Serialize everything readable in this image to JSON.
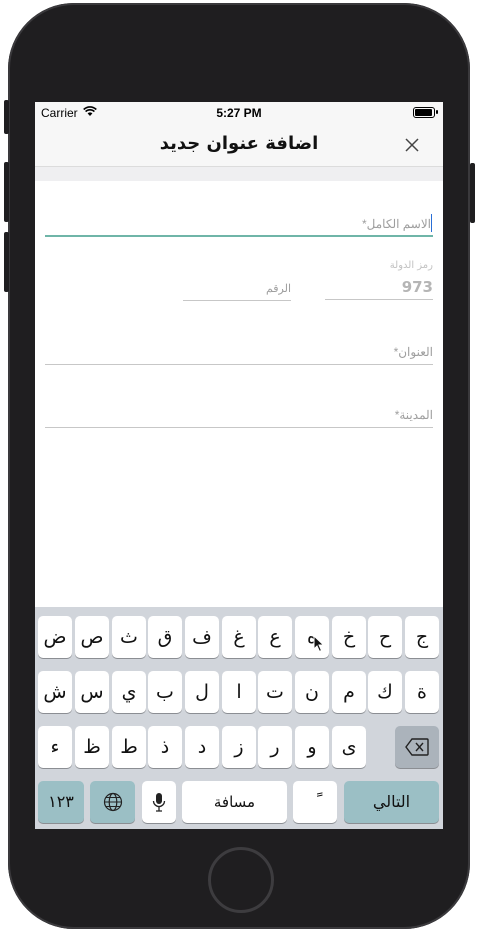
{
  "status_bar": {
    "carrier": "Carrier",
    "time": "5:27 PM"
  },
  "navbar": {
    "title": "اضافة عنوان جديد",
    "close_icon": "close-icon"
  },
  "form": {
    "full_name_placeholder": "الاسم الكامل*",
    "country_code_label": "رمز الدولة",
    "country_code_value": "973",
    "phone_number_placeholder": "الرقم",
    "address_placeholder": "العنوان*",
    "city_placeholder": "المدينة*"
  },
  "keyboard": {
    "row1": [
      "ج",
      "ح",
      "خ",
      "ه",
      "ع",
      "غ",
      "ف",
      "ق",
      "ث",
      "ص",
      "ض"
    ],
    "row2": [
      "ة",
      "ك",
      "م",
      "ن",
      "ت",
      "ا",
      "ل",
      "ب",
      "ي",
      "س",
      "ش"
    ],
    "row3": [
      "ى",
      "و",
      "ر",
      "ز",
      "د",
      "ذ",
      "ط",
      "ظ",
      "ء"
    ],
    "numbers_label": "١٢٣",
    "space_label": "مسافة",
    "diacritic_label": "ً",
    "next_label": "التالي",
    "globe_icon": "globe-icon",
    "mic_icon": "microphone-icon",
    "delete_icon": "backspace-icon"
  }
}
